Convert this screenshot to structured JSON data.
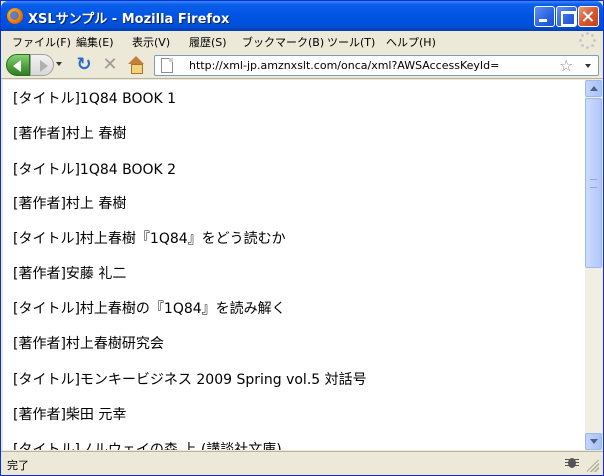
{
  "window": {
    "title": "XSLサンプル - Mozilla Firefox"
  },
  "menu": {
    "items": [
      {
        "label": "ファイル(F)"
      },
      {
        "label": "編集(E)"
      },
      {
        "label": "表示(V)"
      },
      {
        "label": "履歴(S)"
      },
      {
        "label": "ブックマーク(B)"
      },
      {
        "label": "ツール(T)"
      },
      {
        "label": "ヘルプ(H)"
      }
    ]
  },
  "toolbar": {
    "back_icon": "back-arrow-icon",
    "forward_icon": "forward-arrow-icon",
    "reload_glyph": "↻",
    "stop_glyph": "✕",
    "star_glyph": "☆"
  },
  "address": {
    "url": "http://xml-jp.amznxslt.com/onca/xml?AWSAccessKeyId="
  },
  "content": {
    "lines": [
      "[タイトル]1Q84 BOOK 1",
      "[著作者]村上 春樹",
      "[タイトル]1Q84 BOOK 2",
      "[著作者]村上 春樹",
      "[タイトル]村上春樹『1Q84』をどう読むか",
      "[著作者]安藤 礼二",
      "[タイトル]村上春樹の『1Q84』を読み解く",
      "[著作者]村上春樹研究会",
      "[タイトル]モンキービジネス 2009 Spring vol.5 対話号",
      "[著作者]柴田 元幸",
      "[タイトル]ノルウェイの森 上 (講談社文庫)"
    ]
  },
  "status": {
    "text": "完了"
  }
}
